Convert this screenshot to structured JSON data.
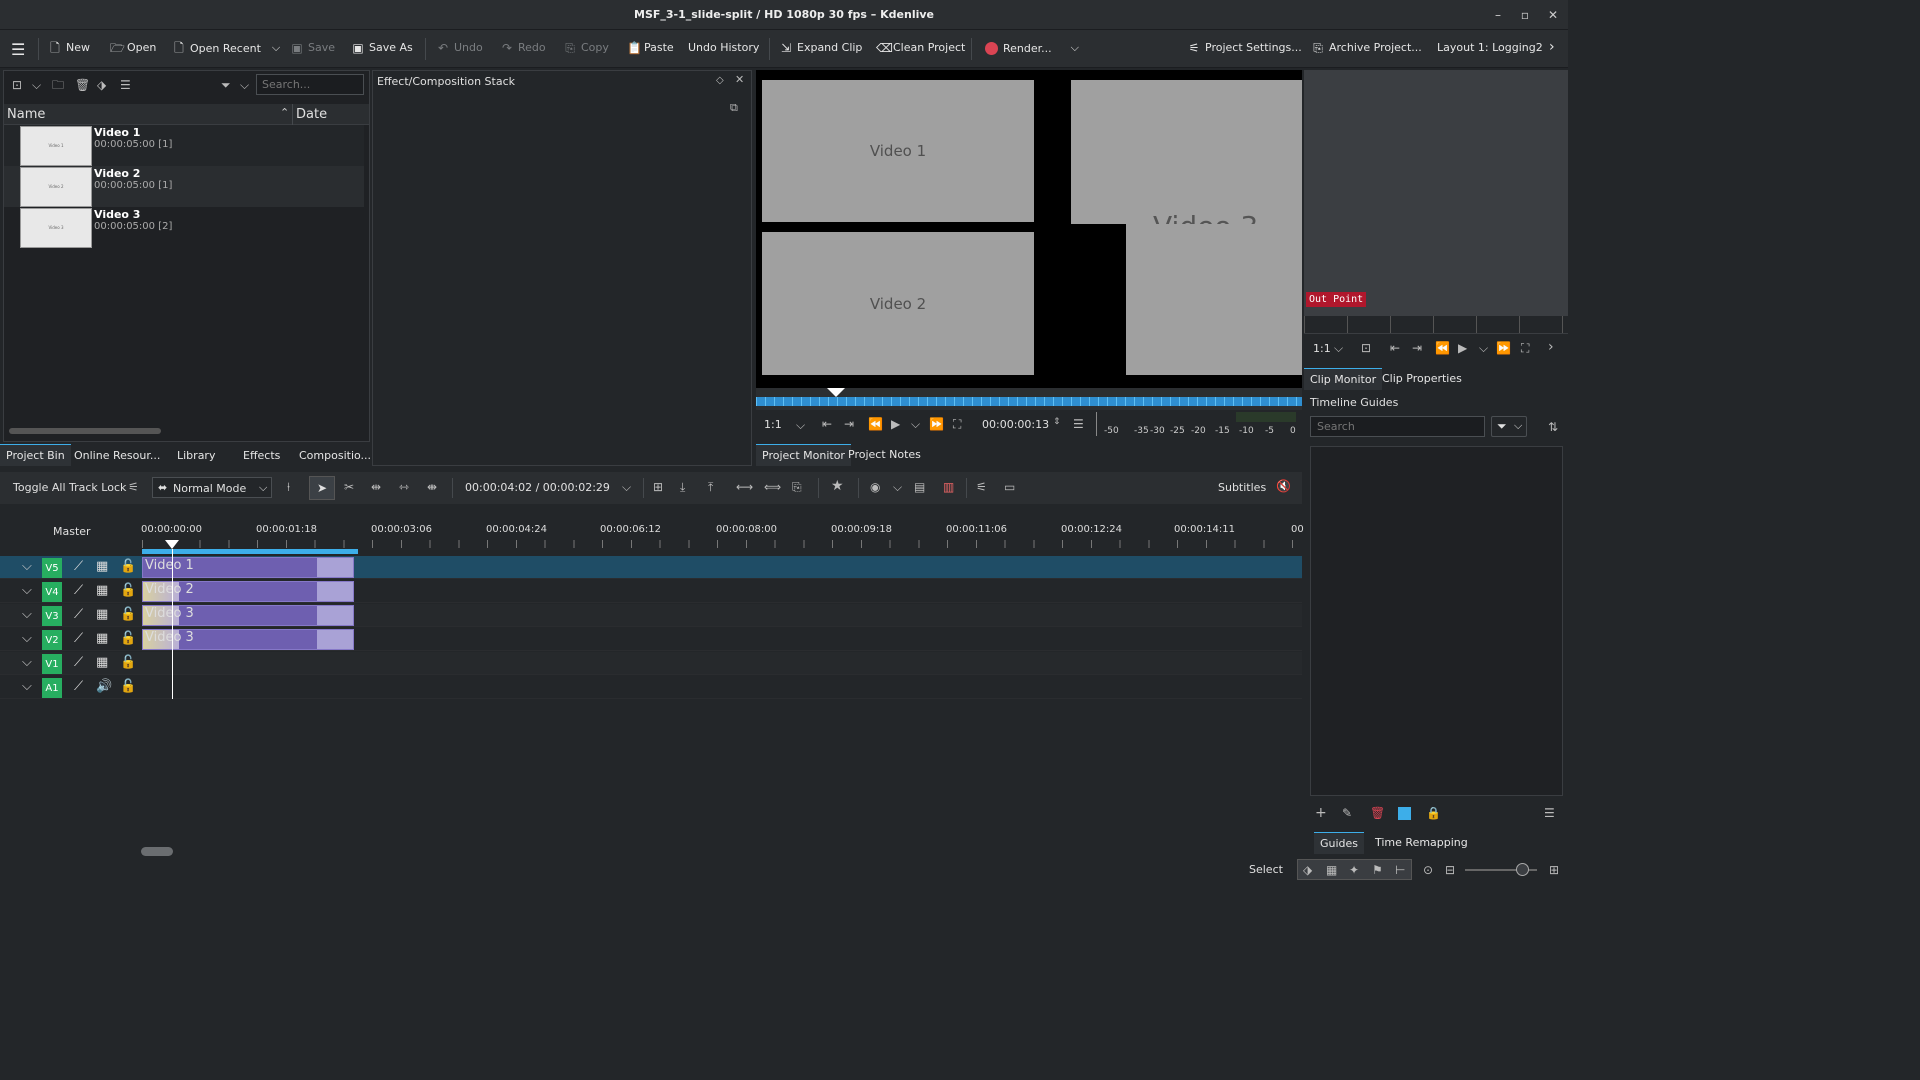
{
  "window": {
    "title": "MSF_3-1_slide-split / HD 1080p 30 fps – Kdenlive"
  },
  "toolbar": {
    "new": "New",
    "open": "Open",
    "open_recent": "Open Recent",
    "save": "Save",
    "save_as": "Save As",
    "undo": "Undo",
    "redo": "Redo",
    "copy": "Copy",
    "paste": "Paste",
    "undo_history": "Undo History",
    "expand_clip": "Expand Clip",
    "clean_project": "Clean Project",
    "render": "Render...",
    "project_settings": "Project Settings...",
    "archive_project": "Archive Project...",
    "layout": "Layout 1: Logging2"
  },
  "bin": {
    "search_placeholder": "Search...",
    "col_name": "Name",
    "col_date": "Date",
    "items": [
      {
        "name": "Video 1",
        "duration": "00:00:05:00 [1]",
        "thumb": "Video 1"
      },
      {
        "name": "Video 2",
        "duration": "00:00:05:00 [1]",
        "thumb": "Video 2"
      },
      {
        "name": "Video 3",
        "duration": "00:00:05:00 [2]",
        "thumb": "Video 3"
      }
    ],
    "tabs": [
      "Project Bin",
      "Online Resour...",
      "Library",
      "Effects",
      "Compositio..."
    ]
  },
  "effect_stack": {
    "title": "Effect/Composition Stack"
  },
  "project_monitor": {
    "boxes": [
      "Video 1",
      "Video 2",
      "Video 3"
    ],
    "zoom": "1:1",
    "timecode": "00:00:00:13",
    "meter_labels": [
      "-50",
      "-35",
      "-30",
      "-25",
      "-20",
      "-15",
      "-10",
      "-5",
      "0"
    ],
    "tabs": [
      "Project Monitor",
      "Project Notes"
    ]
  },
  "clip_monitor": {
    "out_point": "Out Point",
    "zoom": "1:1",
    "tabs": [
      "Clip Monitor",
      "Clip Properties"
    ]
  },
  "guides": {
    "title": "Timeline Guides",
    "search_placeholder": "Search",
    "tabs": [
      "Guides",
      "Time Remapping"
    ]
  },
  "timeline_toolbar": {
    "toggle_lock": "Toggle All Track Lock",
    "mode": "Normal Mode",
    "timecode": "00:00:04:02 / 00:00:02:29",
    "subtitles": "Subtitles"
  },
  "timeline": {
    "master": "Master",
    "ruler": [
      "00:00:00:00",
      "00:00:01:18",
      "00:00:03:06",
      "00:00:04:24",
      "00:00:06:12",
      "00:00:08:00",
      "00:00:09:18",
      "00:00:11:06",
      "00:00:12:24",
      "00:00:14:11",
      "00"
    ],
    "tracks": [
      {
        "label": "V5",
        "clip": "Video 1"
      },
      {
        "label": "V4",
        "clip": "Video 2"
      },
      {
        "label": "V3",
        "clip": "Video 3"
      },
      {
        "label": "V2",
        "clip": "Video 3"
      },
      {
        "label": "V1",
        "clip": ""
      },
      {
        "label": "A1",
        "clip": ""
      }
    ]
  },
  "statusbar": {
    "select": "Select"
  },
  "colors": {
    "accent": "#3daee9",
    "track_label": "#27ae60",
    "clip": "#6e5fb0",
    "render_dot": "#da4453"
  }
}
